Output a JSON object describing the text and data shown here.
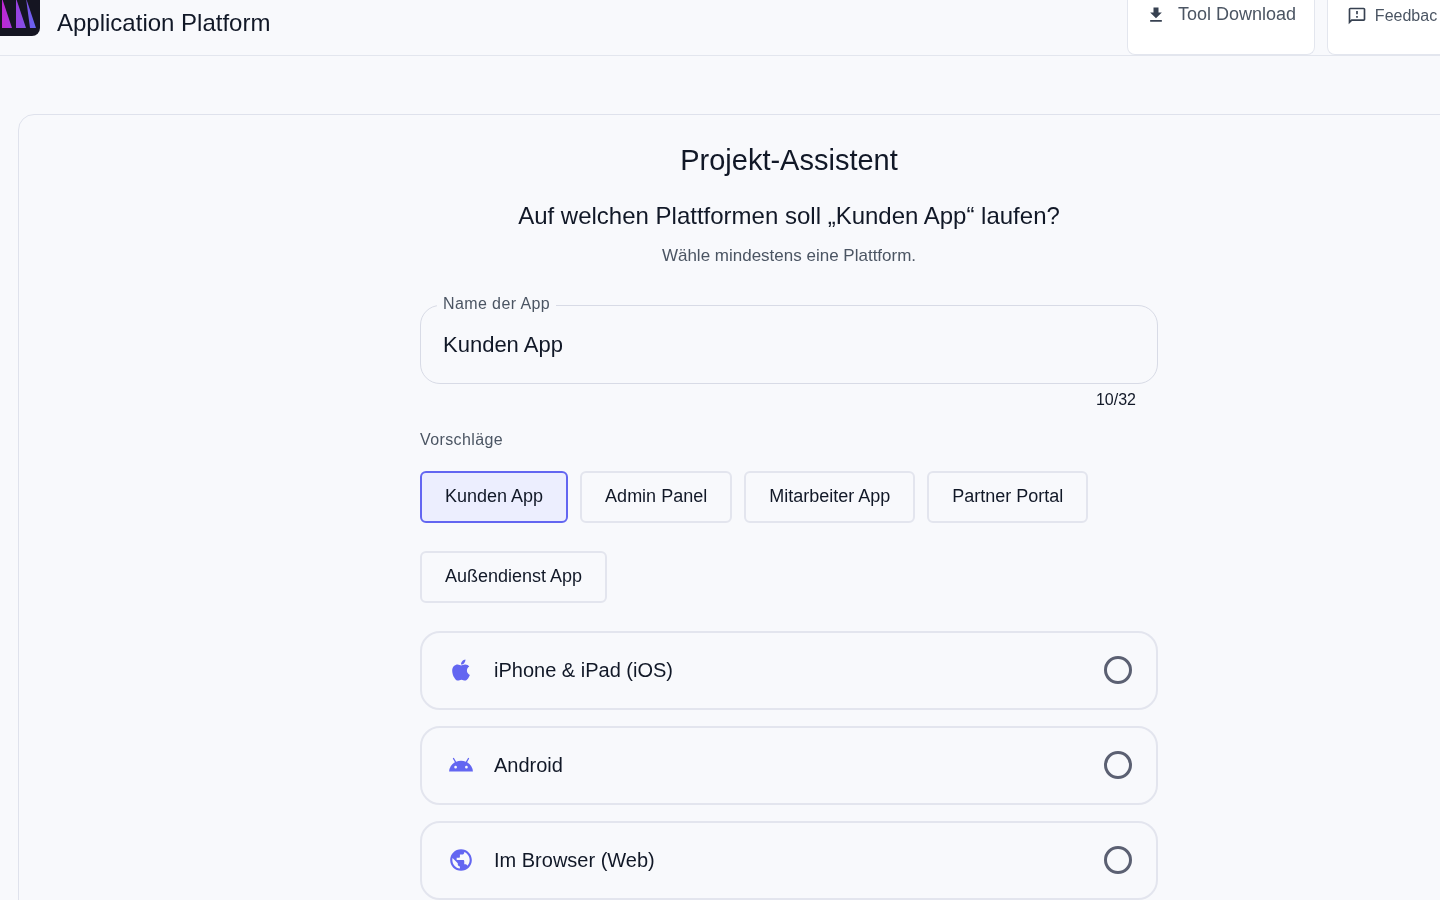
{
  "header": {
    "title": "Application Platform",
    "buttons": [
      {
        "kind": "download",
        "label": "Tool Download"
      },
      {
        "kind": "feedback",
        "label": "Feedbac"
      }
    ]
  },
  "wizard": {
    "title": "Projekt-Assistent",
    "question": "Auf welchen Plattformen soll „Kunden App“ laufen?",
    "hint": "Wähle mindestens eine Plattform.",
    "name_field": {
      "label": "Name der App",
      "value": "Kunden App",
      "counter": "10/32"
    },
    "suggestions_label": "Vorschläge",
    "suggestions": [
      {
        "label": "Kunden App",
        "selected": true
      },
      {
        "label": "Admin Panel",
        "selected": false
      },
      {
        "label": "Mitarbeiter App",
        "selected": false
      },
      {
        "label": "Partner Portal",
        "selected": false
      },
      {
        "label": "Außendienst App",
        "selected": false
      }
    ],
    "platforms": [
      {
        "kind": "apple",
        "label": "iPhone & iPad (iOS)",
        "selected": false
      },
      {
        "kind": "android",
        "label": "Android",
        "selected": false
      },
      {
        "kind": "web",
        "label": "Im Browser (Web)",
        "selected": false
      }
    ]
  }
}
